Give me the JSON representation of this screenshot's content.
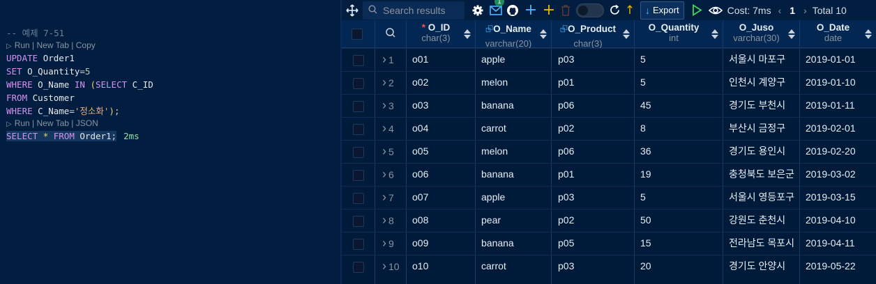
{
  "editor": {
    "comment": "-- 예제 7-51",
    "lens1": "Run | New Tab | Copy",
    "lens2": "Run | New Tab | JSON",
    "lines": {
      "l1_kw": "UPDATE",
      "l1_id": "Order1",
      "l2_kw": "SET",
      "l2_id": "O_Quantity",
      "l2_op": "=",
      "l2_num": "5",
      "l3_kw1": "WHERE",
      "l3_id": "O_Name",
      "l3_kw2": "IN",
      "l3_p": "(",
      "l3_kw3": "SELECT",
      "l3_id2": "C_ID",
      "l4_kw": "FROM",
      "l4_id": "Customer",
      "l5_kw": "WHERE",
      "l5_id": "C_Name",
      "l5_op": "=",
      "l5_str": "'정소화'",
      "l5_p": ")",
      "l5_semi": ";",
      "l6_kw1": "SELECT",
      "l6_star": "*",
      "l6_kw2": "FROM",
      "l6_id": "Order1",
      "l6_semi": ";",
      "l6_time": "2ms"
    }
  },
  "toolbar": {
    "search_placeholder": "Search results",
    "notification_count": "1",
    "export_label": "Export",
    "cost_label": "Cost: 7ms",
    "page": "1",
    "total_label": "Total 10",
    "icons": [
      "move-icon",
      "search-icon",
      "gear-icon",
      "mail-icon",
      "github-icon",
      "add-icon",
      "add-row-icon",
      "trash-icon",
      "toggle",
      "refresh-icon",
      "arrow-up-icon",
      "download-icon",
      "run-icon",
      "eye-icon",
      "chevron-left-icon",
      "chevron-right-icon"
    ]
  },
  "columns": [
    {
      "name": "O_ID",
      "type": "char(3)",
      "required": "*",
      "key": ""
    },
    {
      "name": "O_Name",
      "type": "varchar(20)",
      "required": "",
      "key": "⮺"
    },
    {
      "name": "O_Product",
      "type": "char(3)",
      "required": "",
      "key": "⮺"
    },
    {
      "name": "O_Quantity",
      "type": "int",
      "required": "",
      "key": ""
    },
    {
      "name": "O_Juso",
      "type": "varchar(30)",
      "required": "",
      "key": ""
    },
    {
      "name": "O_Date",
      "type": "date",
      "required": "",
      "key": ""
    }
  ],
  "rows": [
    {
      "n": "1",
      "c": [
        "o01",
        "apple",
        "p03",
        "5",
        "서울시 마포구",
        "2019-01-01"
      ]
    },
    {
      "n": "2",
      "c": [
        "o02",
        "melon",
        "p01",
        "5",
        "인천시 계양구",
        "2019-01-10"
      ]
    },
    {
      "n": "3",
      "c": [
        "o03",
        "banana",
        "p06",
        "45",
        "경기도 부천시",
        "2019-01-11"
      ]
    },
    {
      "n": "4",
      "c": [
        "o04",
        "carrot",
        "p02",
        "8",
        "부산시 금정구",
        "2019-02-01"
      ]
    },
    {
      "n": "5",
      "c": [
        "o05",
        "melon",
        "p06",
        "36",
        "경기도 용인시",
        "2019-02-20"
      ]
    },
    {
      "n": "6",
      "c": [
        "o06",
        "banana",
        "p01",
        "19",
        "충청북도 보은군",
        "2019-03-02"
      ]
    },
    {
      "n": "7",
      "c": [
        "o07",
        "apple",
        "p03",
        "5",
        "서울시 영등포구",
        "2019-03-15"
      ]
    },
    {
      "n": "8",
      "c": [
        "o08",
        "pear",
        "p02",
        "50",
        "강원도 춘천시",
        "2019-04-10"
      ]
    },
    {
      "n": "9",
      "c": [
        "o09",
        "banana",
        "p05",
        "15",
        "전라남도 목포시",
        "2019-04-11"
      ]
    },
    {
      "n": "10",
      "c": [
        "o10",
        "carrot",
        "p03",
        "20",
        "경기도 안양시",
        "2019-05-22"
      ]
    }
  ]
}
